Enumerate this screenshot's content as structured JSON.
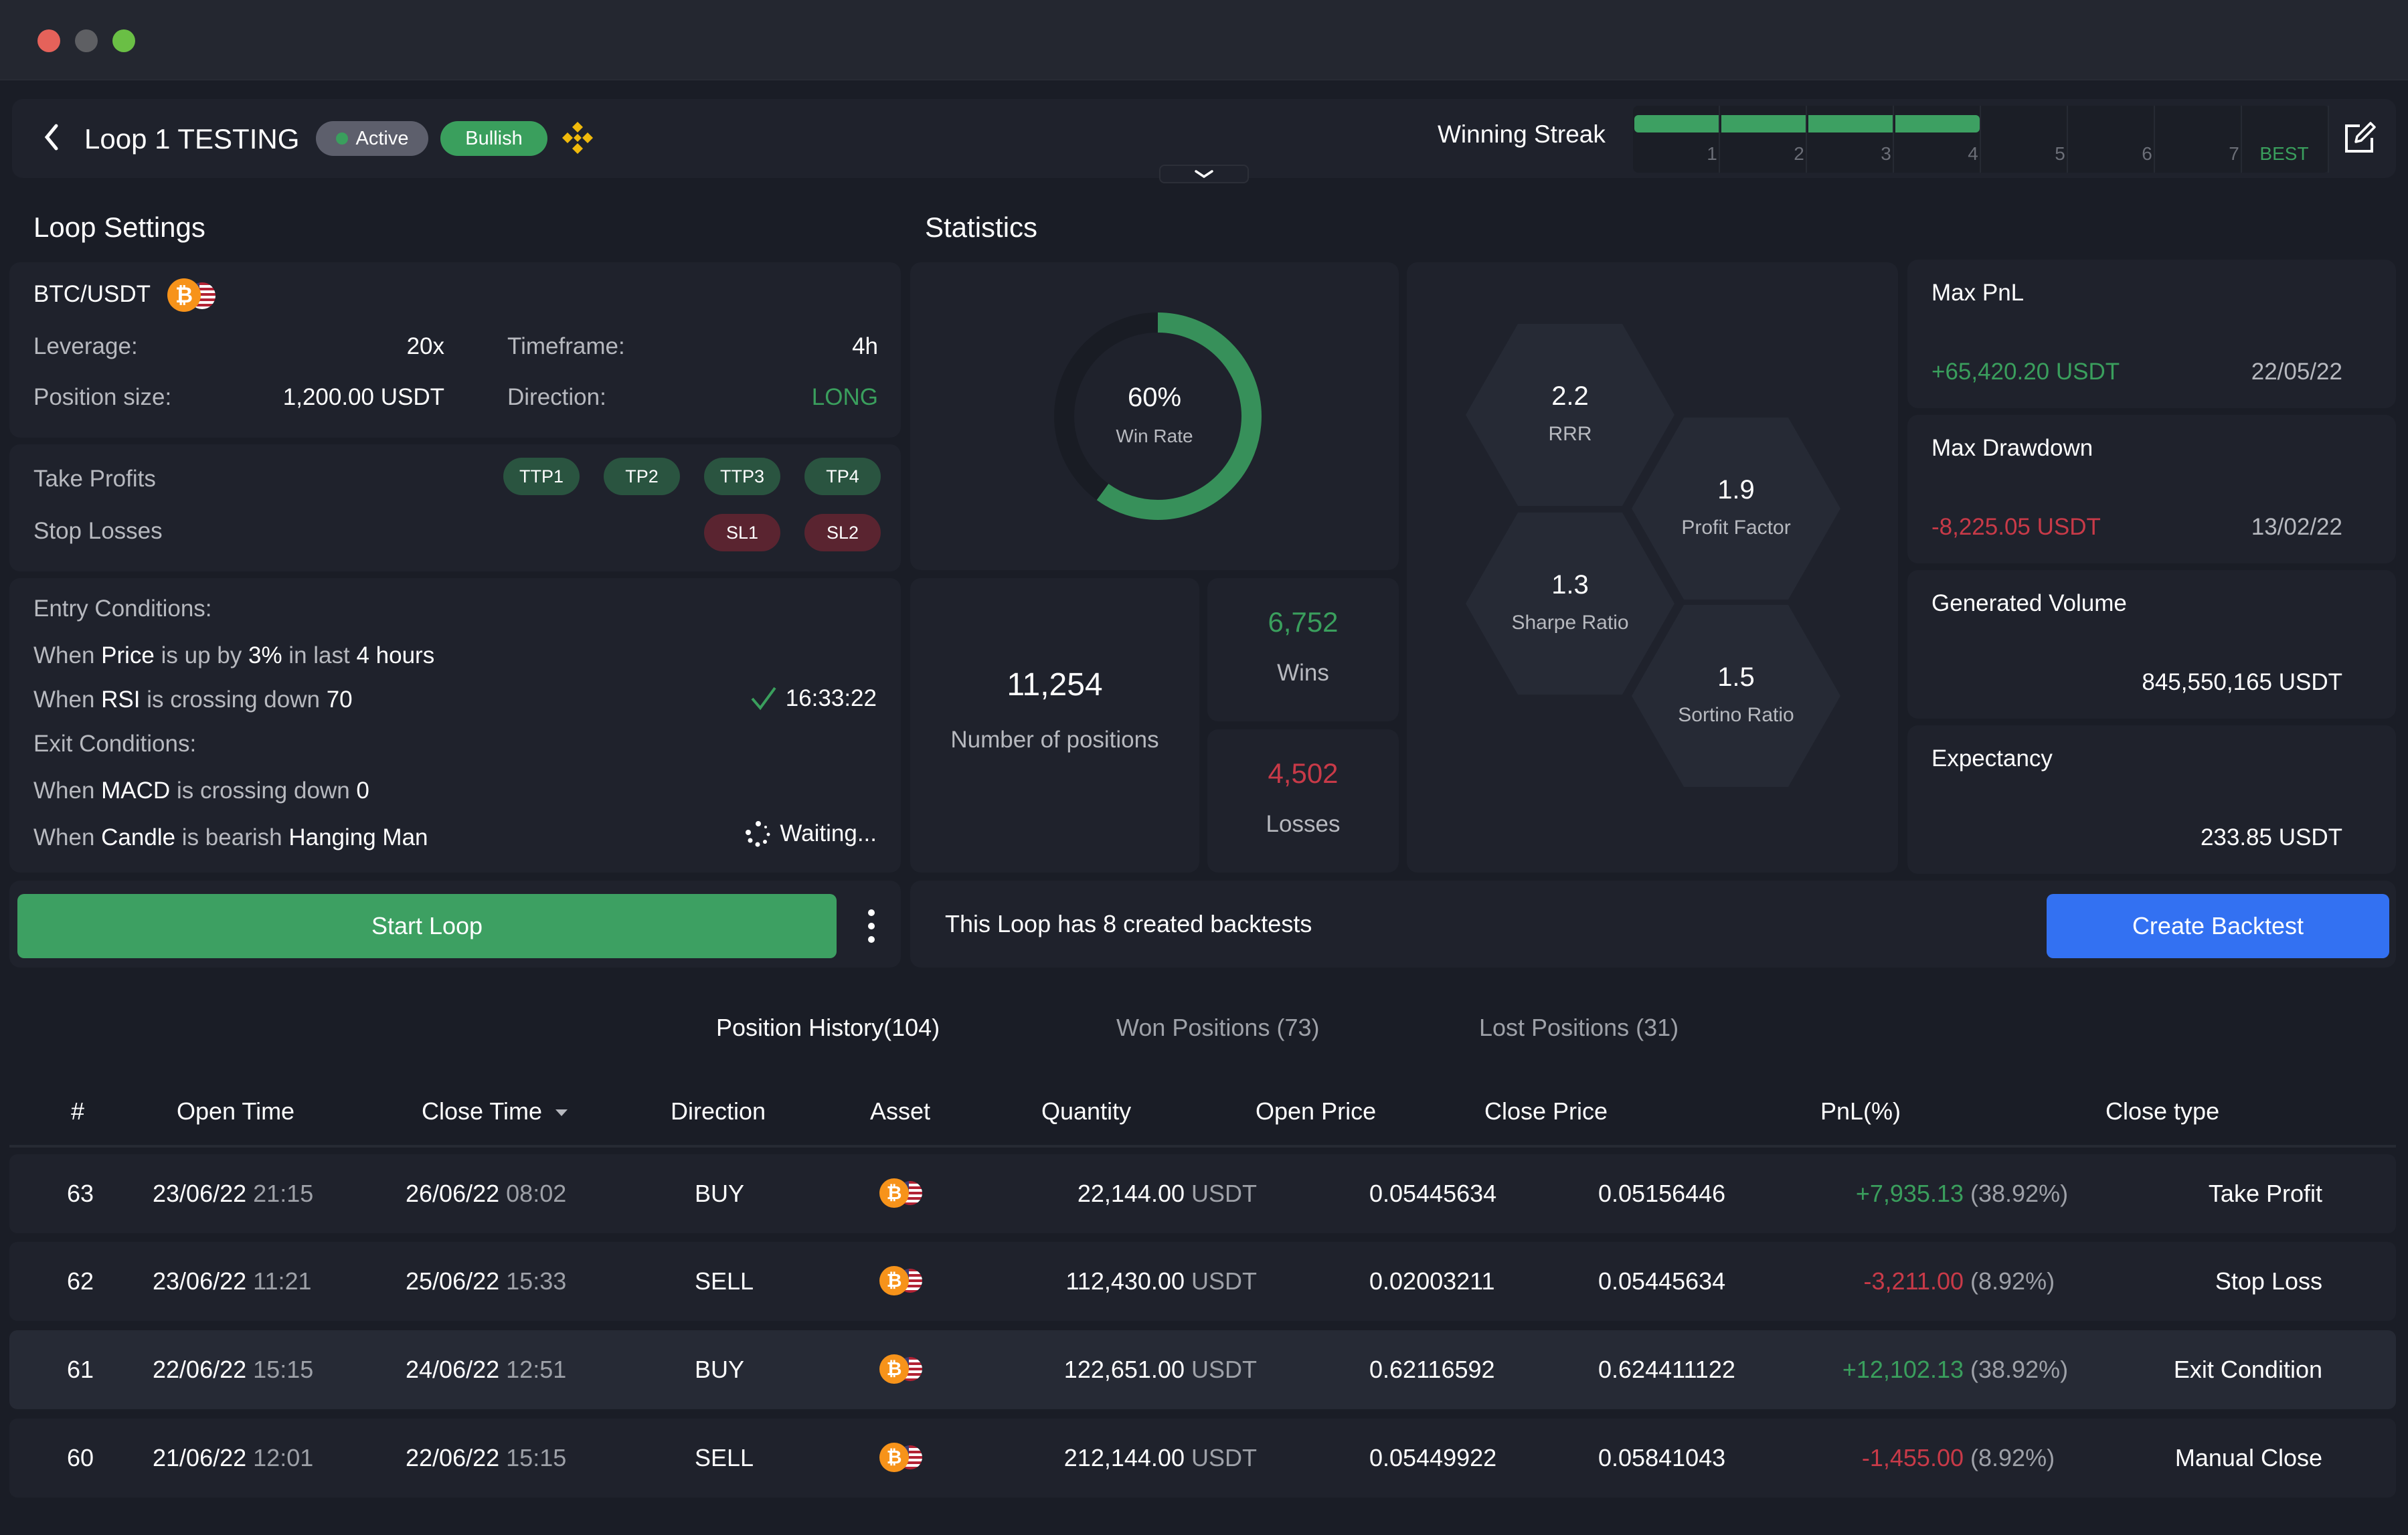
{
  "window": {
    "controls": [
      "close",
      "minimize",
      "maximize"
    ],
    "colors": {
      "close": "#e5625a",
      "minimize": "#5e5f63",
      "maximize": "#6abf45"
    }
  },
  "header": {
    "back_icon": "chevron-left-icon",
    "title": "Loop 1 TESTING",
    "status_badge": "Active",
    "sentiment_badge": "Bullish",
    "exchange_icon": "binance-icon",
    "winning_streak": {
      "label": "Winning Streak",
      "current": 4,
      "ticks": [
        "1",
        "2",
        "3",
        "4",
        "5",
        "6",
        "7",
        "BEST"
      ]
    },
    "edit_icon": "edit-icon",
    "expand_icon": "chevron-down-icon"
  },
  "loop_settings": {
    "heading": "Loop Settings",
    "pair": "BTC/USDT",
    "leverage_label": "Leverage:",
    "leverage": "20x",
    "timeframe_label": "Timeframe:",
    "timeframe": "4h",
    "position_size_label": "Position size:",
    "position_size": "1,200.00 USDT",
    "direction_label": "Direction:",
    "direction": "LONG",
    "take_profits_label": "Take Profits",
    "take_profits": [
      "TTP1",
      "TP2",
      "TTP3",
      "TP4"
    ],
    "stop_losses_label": "Stop Losses",
    "stop_losses": [
      "SL1",
      "SL2"
    ],
    "entry_label": "Entry Conditions:",
    "entry": [
      {
        "parts": [
          "When ",
          "Price",
          " is up by ",
          "3%",
          " in last ",
          "4 hours"
        ],
        "status": ""
      },
      {
        "parts": [
          "When ",
          "RSI",
          " is crossing down ",
          "70"
        ],
        "status": "16:33:22"
      }
    ],
    "exit_label": "Exit Conditions:",
    "exit": [
      {
        "parts": [
          "When ",
          "MACD",
          " is crossing down ",
          "0"
        ],
        "status": ""
      },
      {
        "parts": [
          "When ",
          "Candle",
          " is bearish ",
          "Hanging Man"
        ],
        "status": "Waiting..."
      }
    ]
  },
  "statistics": {
    "heading": "Statistics",
    "win_rate": {
      "value": "60%",
      "label": "Win Rate",
      "fraction": 0.6
    },
    "positions": {
      "value": "11,254",
      "label": "Number of positions"
    },
    "wins": {
      "value": "6,752",
      "label": "Wins"
    },
    "losses": {
      "value": "4,502",
      "label": "Losses"
    },
    "ratios": [
      {
        "value": "2.2",
        "label": "RRR"
      },
      {
        "value": "1.9",
        "label": "Profit Factor"
      },
      {
        "value": "1.3",
        "label": "Sharpe Ratio"
      },
      {
        "value": "1.5",
        "label": "Sortino Ratio"
      }
    ],
    "max_pnl": {
      "label": "Max PnL",
      "value": "+65,420.20 USDT",
      "date": "22/05/22"
    },
    "max_drawdown": {
      "label": "Max Drawdown",
      "value": "-8,225.05 USDT",
      "date": "13/02/22"
    },
    "generated_volume": {
      "label": "Generated Volume",
      "value": "845,550,165 USDT"
    },
    "expectancy": {
      "label": "Expectancy",
      "value": "233.85 USDT"
    }
  },
  "actions": {
    "start_loop": "Start Loop",
    "more_icon": "more-vertical-icon",
    "backtest_info": "This Loop has 8 created backtests",
    "create_backtest": "Create Backtest"
  },
  "tabs": [
    {
      "label": "Position History(104)",
      "active": true
    },
    {
      "label": "Won Positions (73)",
      "active": false
    },
    {
      "label": "Lost Positions (31)",
      "active": false
    }
  ],
  "table": {
    "columns": [
      "#",
      "Open Time",
      "Close Time",
      "Direction",
      "Asset",
      "Quantity",
      "Open Price",
      "Close Price",
      "PnL(%)",
      "Close type"
    ],
    "sort_icon": "sort-down-icon",
    "rows": [
      {
        "id": "63",
        "open_date": "23/06/22",
        "open_time": "21:15",
        "close_date": "26/06/22",
        "close_time": "08:02",
        "direction": "BUY",
        "qty": "22,144.00",
        "qty_unit": "USDT",
        "open_price": "0.05445634",
        "close_price": "0.05156446",
        "pnl": "+7,935.13",
        "pnl_pct": "(38.92%)",
        "close_type": "Take Profit"
      },
      {
        "id": "62",
        "open_date": "23/06/22",
        "open_time": "11:21",
        "close_date": "25/06/22",
        "close_time": "15:33",
        "direction": "SELL",
        "qty": "112,430.00",
        "qty_unit": "USDT",
        "open_price": "0.02003211",
        "close_price": "0.05445634",
        "pnl": "-3,211.00",
        "pnl_pct": "(8.92%)",
        "close_type": "Stop Loss"
      },
      {
        "id": "61",
        "open_date": "22/06/22",
        "open_time": "15:15",
        "close_date": "24/06/22",
        "close_time": "12:51",
        "direction": "BUY",
        "qty": "122,651.00",
        "qty_unit": "USDT",
        "open_price": "0.62116592",
        "close_price": "0.624411122",
        "pnl": "+12,102.13",
        "pnl_pct": "(38.92%)",
        "close_type": "Exit Condition"
      },
      {
        "id": "60",
        "open_date": "21/06/22",
        "open_time": "12:01",
        "close_date": "22/06/22",
        "close_time": "15:15",
        "direction": "SELL",
        "qty": "212,144.00",
        "qty_unit": "USDT",
        "open_price": "0.05449922",
        "close_price": "0.05841043",
        "pnl": "-1,455.00",
        "pnl_pct": "(8.92%)",
        "close_type": "Manual Close"
      }
    ]
  },
  "colors": {
    "positive": "#3a9f5d",
    "negative": "#c83a48",
    "accent_blue": "#3371f2",
    "binance": "#f0b90b"
  }
}
